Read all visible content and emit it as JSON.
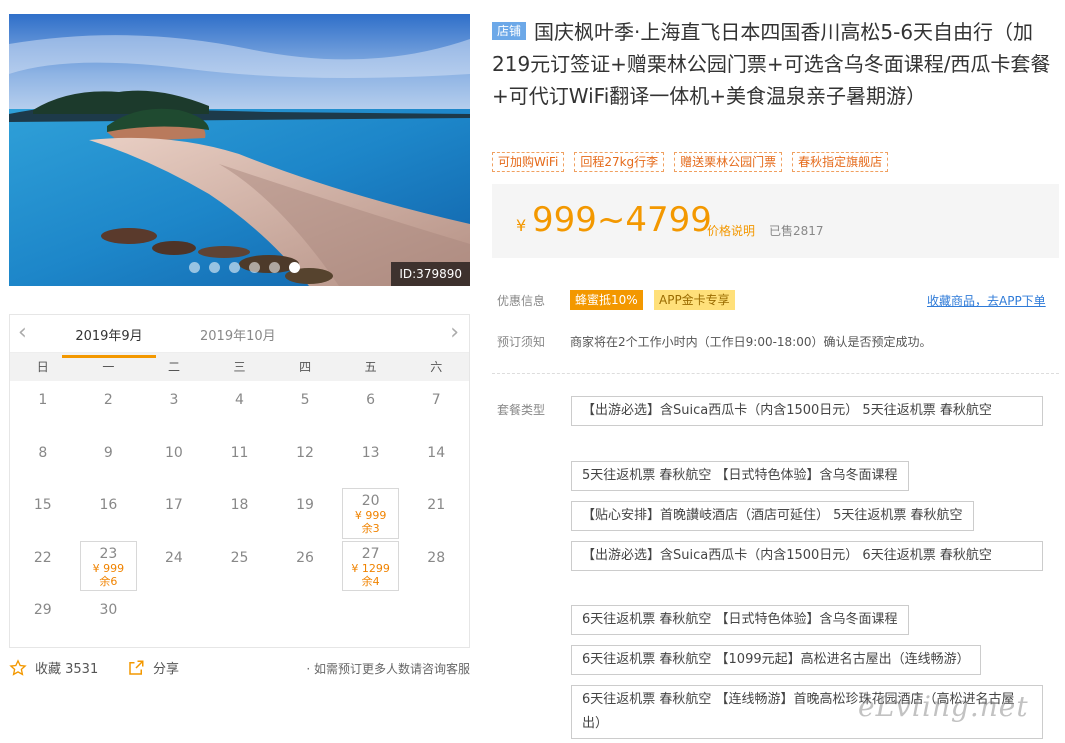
{
  "hero": {
    "id_tag": "ID:379890",
    "slides": 6,
    "active_slide": 6
  },
  "calendar": {
    "months": [
      "2019年9月",
      "2019年10月"
    ],
    "weekdays": [
      "日",
      "一",
      "二",
      "三",
      "四",
      "五",
      "六"
    ],
    "days": [
      {
        "d": "1"
      },
      {
        "d": "2"
      },
      {
        "d": "3"
      },
      {
        "d": "4"
      },
      {
        "d": "5"
      },
      {
        "d": "6"
      },
      {
        "d": "7"
      },
      {
        "d": "8"
      },
      {
        "d": "9"
      },
      {
        "d": "10"
      },
      {
        "d": "11"
      },
      {
        "d": "12"
      },
      {
        "d": "13"
      },
      {
        "d": "14"
      },
      {
        "d": "15"
      },
      {
        "d": "16"
      },
      {
        "d": "17"
      },
      {
        "d": "18"
      },
      {
        "d": "19"
      },
      {
        "d": "20",
        "price": "¥ 999",
        "remain": "余3"
      },
      {
        "d": "21"
      },
      {
        "d": "22"
      },
      {
        "d": "23",
        "price": "¥ 999",
        "remain": "余6"
      },
      {
        "d": "24"
      },
      {
        "d": "25"
      },
      {
        "d": "26"
      },
      {
        "d": "27",
        "price": "¥ 1299",
        "remain": "余4"
      },
      {
        "d": "28"
      },
      {
        "d": "29"
      },
      {
        "d": "30"
      }
    ]
  },
  "actions": {
    "fav_label": "收藏 3531",
    "share_label": "分享",
    "hint": "· 如需预订更多人数请咨询客服"
  },
  "product": {
    "shop_badge": "店铺",
    "title": "国庆枫叶季·上海直飞日本四国香川高松5-6天自由行（加219元订签证+赠栗林公园门票+可选含乌冬面课程/西瓜卡套餐+可代订WiFi翻译一体机+美食温泉亲子暑期游）",
    "tags": [
      "可加购WiFi",
      "回程27kg行李",
      "赠送栗林公园门票",
      "春秋指定旗舰店"
    ],
    "price_currency": "¥",
    "price": "999~4799",
    "price_explain": "价格说明",
    "sold": "已售2817"
  },
  "offers": {
    "label": "优惠信息",
    "promo1": "蜂蜜抵10%",
    "promo2": "APP金卡专享",
    "fav_link": "收藏商品，去APP下单"
  },
  "booking": {
    "label": "预订须知",
    "text": "商家将在2个工作小时内（工作日9:00-18:00）确认是否预定成功。"
  },
  "packages": {
    "label": "套餐类型",
    "items": [
      "【出游必选】含Suica西瓜卡（内含1500日元） 5天往返机票 春秋航空",
      "5天往返机票 春秋航空 【日式特色体验】含乌冬面课程",
      "【贴心安排】首晚讃岐酒店（酒店可延住） 5天往返机票 春秋航空",
      "【出游必选】含Suica西瓜卡（内含1500日元） 6天往返机票 春秋航空",
      "6天往返机票 春秋航空 【日式特色体验】含乌冬面课程",
      "6天往返机票 春秋航空 【1099元起】高松进名古屋出（连线畅游）",
      "6天往返机票 春秋航空 【连线畅游】首晚高松珍珠花园酒店（高松进名古屋出）"
    ]
  },
  "watermark": "eLvling.net",
  "colors": {
    "accent": "#f39800",
    "link": "#2f7bd8",
    "shop_badge": "#6ca8e8"
  }
}
